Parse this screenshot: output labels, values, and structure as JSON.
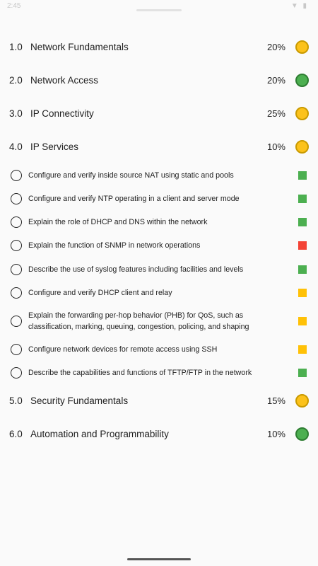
{
  "status": {
    "time": "2:45",
    "icons": "◉ ⊙",
    "right_icons": "▼ ▮"
  },
  "sections": [
    {
      "num": "1.0",
      "title": "Network Fundamentals",
      "pct": "20%",
      "status": "yellow"
    },
    {
      "num": "2.0",
      "title": "Network Access",
      "pct": "20%",
      "status": "green"
    },
    {
      "num": "3.0",
      "title": "IP Connectivity",
      "pct": "25%",
      "status": "yellow"
    },
    {
      "num": "4.0",
      "title": "IP Services",
      "pct": "10%",
      "status": "yellow"
    },
    {
      "num": "5.0",
      "title": "Security Fundamentals",
      "pct": "15%",
      "status": "yellow"
    },
    {
      "num": "6.0",
      "title": "Automation and Programmability",
      "pct": "10%",
      "status": "green"
    }
  ],
  "topics": [
    {
      "text": "Configure and verify inside source NAT using static and pools",
      "status": "green"
    },
    {
      "text": "Configure and verify NTP operating in a client and server mode",
      "status": "green"
    },
    {
      "text": "Explain the role of DHCP and DNS within the network",
      "status": "green"
    },
    {
      "text": "Explain the function of SNMP in network operations",
      "status": "red"
    },
    {
      "text": "Describe the use of syslog features including facilities and levels",
      "status": "green"
    },
    {
      "text": "Configure and verify DHCP client and relay",
      "status": "yellow"
    },
    {
      "text": "Explain the forwarding per-hop behavior (PHB) for QoS, such as classification, marking, queuing, congestion, policing, and shaping",
      "status": "yellow"
    },
    {
      "text": "Configure network devices for remote access using SSH",
      "status": "yellow"
    },
    {
      "text": "Describe the capabilities and functions of TFTP/FTP in the network",
      "status": "green"
    }
  ],
  "colors": {
    "yellow": "#fcc21b",
    "green": "#4caf50",
    "red": "#f44336",
    "square_yellow": "#ffc107"
  }
}
